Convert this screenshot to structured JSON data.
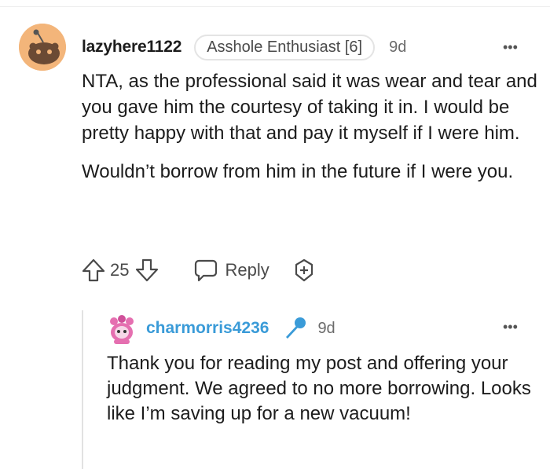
{
  "comment": {
    "username": "lazyhere1122",
    "flair": "Asshole Enthusiast [6]",
    "age": "9d",
    "more": "•••",
    "paragraphs": [
      "NTA, as the professional said it was wear and tear and you gave him the courtesy of taking it in. I would be pretty happy with that and pay it myself if I were him.",
      "Wouldn’t borrow from him in the future if I were you."
    ],
    "vote_count": "25",
    "reply_label": "Reply",
    "icons": [
      "snoo-avatar-icon",
      "upvote-icon",
      "downvote-icon",
      "reply-bubble-icon",
      "award-icon",
      "more-options-icon"
    ]
  },
  "reply": {
    "username": "charmorris4236",
    "age": "9d",
    "more": "•••",
    "text": "Thank you for reading my post and offering your judgment. We agreed to no more borrowing. Looks like I’m saving up for a new vacuum!",
    "icons": [
      "pink-snoo-avatar-icon",
      "microphone-icon",
      "more-options-icon"
    ]
  },
  "colors": {
    "reply_username": "#3a9bd8",
    "mic": "#3a9bd8",
    "avatar_bg": "#f3b57a"
  }
}
